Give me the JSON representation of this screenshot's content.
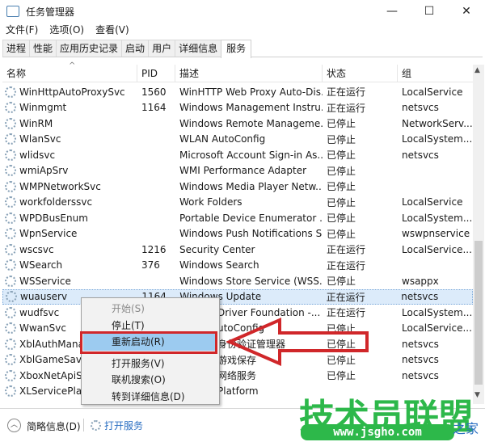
{
  "window": {
    "title": "任务管理器",
    "minimize": "—",
    "maximize": "☐",
    "close": "✕"
  },
  "menu": [
    "文件(F)",
    "选项(O)",
    "查看(V)"
  ],
  "tabs": [
    "进程",
    "性能",
    "应用历史记录",
    "启动",
    "用户",
    "详细信息",
    "服务"
  ],
  "columns": {
    "name": "名称",
    "pid": "PID",
    "desc": "描述",
    "status": "状态",
    "group": "组"
  },
  "rows": [
    {
      "name": "WinHttpAutoProxySvc",
      "pid": "1560",
      "desc": "WinHTTP Web Proxy Auto-Dis...",
      "status": "正在运行",
      "group": "LocalService"
    },
    {
      "name": "Winmgmt",
      "pid": "1164",
      "desc": "Windows Management Instru...",
      "status": "正在运行",
      "group": "netsvcs"
    },
    {
      "name": "WinRM",
      "pid": "",
      "desc": "Windows Remote Manageme...",
      "status": "已停止",
      "group": "NetworkServ..."
    },
    {
      "name": "WlanSvc",
      "pid": "",
      "desc": "WLAN AutoConfig",
      "status": "已停止",
      "group": "LocalSystem..."
    },
    {
      "name": "wlidsvc",
      "pid": "",
      "desc": "Microsoft Account Sign-in As...",
      "status": "已停止",
      "group": "netsvcs"
    },
    {
      "name": "wmiApSrv",
      "pid": "",
      "desc": "WMI Performance Adapter",
      "status": "已停止",
      "group": ""
    },
    {
      "name": "WMPNetworkSvc",
      "pid": "",
      "desc": "Windows Media Player Netw...",
      "status": "已停止",
      "group": ""
    },
    {
      "name": "workfolderssvc",
      "pid": "",
      "desc": "Work Folders",
      "status": "已停止",
      "group": "LocalService"
    },
    {
      "name": "WPDBusEnum",
      "pid": "",
      "desc": "Portable Device Enumerator ...",
      "status": "已停止",
      "group": "LocalSystem..."
    },
    {
      "name": "WpnService",
      "pid": "",
      "desc": "Windows Push Notifications S...",
      "status": "已停止",
      "group": "wswpnservice"
    },
    {
      "name": "wscsvc",
      "pid": "1216",
      "desc": "Security Center",
      "status": "正在运行",
      "group": "LocalService..."
    },
    {
      "name": "WSearch",
      "pid": "376",
      "desc": "Windows Search",
      "status": "正在运行",
      "group": ""
    },
    {
      "name": "WSService",
      "pid": "",
      "desc": "Windows Store Service (WSS...",
      "status": "已停止",
      "group": "wsappx"
    },
    {
      "name": "wuauserv",
      "pid": "1164",
      "desc": "Windows Update",
      "status": "正在运行",
      "group": "netsvcs"
    },
    {
      "name": "wudfsvc",
      "pid": "",
      "desc": "Driver Foundation -...",
      "status": "正在运行",
      "group": "LocalSystem..."
    },
    {
      "name": "WwanSvc",
      "pid": "",
      "desc": "utoConfig",
      "status": "已停止",
      "group": "LocalService..."
    },
    {
      "name": "XblAuthManage",
      "pid": "",
      "desc": "身份验证管理器",
      "status": "已停止",
      "group": "netsvcs"
    },
    {
      "name": "XblGameSave",
      "pid": "",
      "desc": "游戏保存",
      "status": "已停止",
      "group": "netsvcs"
    },
    {
      "name": "XboxNetApiSvc",
      "pid": "",
      "desc": "网络服务",
      "status": "已停止",
      "group": "netsvcs"
    },
    {
      "name": "XLServicePlatfo",
      "pid": "",
      "desc": "Platform",
      "status": "",
      "group": ""
    }
  ],
  "context_menu": {
    "start": "开始(S)",
    "stop": "停止(T)",
    "restart": "重新启动(R)",
    "open_services": "打开服务(V)",
    "search_online": "联机搜索(O)",
    "go_to_details": "转到详细信息(D)"
  },
  "footer": {
    "brief": "简略信息(D)",
    "open_services": "打开服务"
  },
  "watermark": {
    "brand": "技术员联盟",
    "url": "www.jsgho.com",
    "sub": "之家"
  },
  "colors": {
    "highlight": "#9ccbf0",
    "annotation": "#d0272a",
    "watermark": "#2db84a"
  }
}
